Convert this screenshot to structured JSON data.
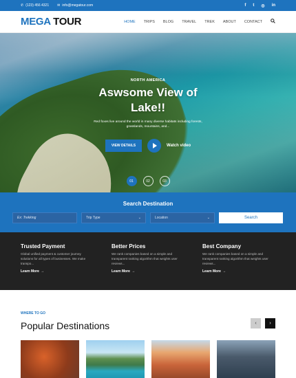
{
  "topbar": {
    "phone": "(123) 456 4321",
    "email": "info@megatour.com",
    "social": [
      "f",
      "t",
      "◎",
      "in"
    ]
  },
  "nav": {
    "logo_part1": "MEGA",
    "logo_part2": "TOUR",
    "items": [
      "HOME",
      "TRIPS",
      "BLOG",
      "TRAVEL",
      "TREK",
      "ABOUT",
      "CONTACT"
    ],
    "active": "HOME",
    "search_icon": "search-icon"
  },
  "hero": {
    "eyebrow": "NORTH AMERICA",
    "title_line1": "Aswsome View of",
    "title_line2": "Lake!!",
    "description": "Red foxes live around the world in many diverse habitats including forests, grasslands, mountains, and...",
    "details_button": "VIEW DETAILS",
    "watch_label": "Watch video",
    "slides": [
      "01",
      "02",
      "03"
    ],
    "active_slide": "01"
  },
  "search": {
    "title": "Search Destination",
    "keyword_placeholder": "Ex: Trekking",
    "trip_type": "Trip Type",
    "location": "Location",
    "button": "Search"
  },
  "features": [
    {
      "title": "Trusted Payment",
      "text": "Global unified payment & customer journey solutions for all types of businesses. We make transpo...",
      "more": "Learn More"
    },
    {
      "title": "Better Prices",
      "text": "We rank companies based on a simple and transparent ranking algorithm that weights user reviews...",
      "more": "Learn More"
    },
    {
      "title": "Best Company",
      "text": "We rank companies based on a simple and transparent ranking algorithm that weights user reviews...",
      "more": "Learn More"
    }
  ],
  "destinations": {
    "eyebrow": "WHERE TO GO",
    "title": "Popular Destinations",
    "prev": "‹",
    "next": "›"
  }
}
